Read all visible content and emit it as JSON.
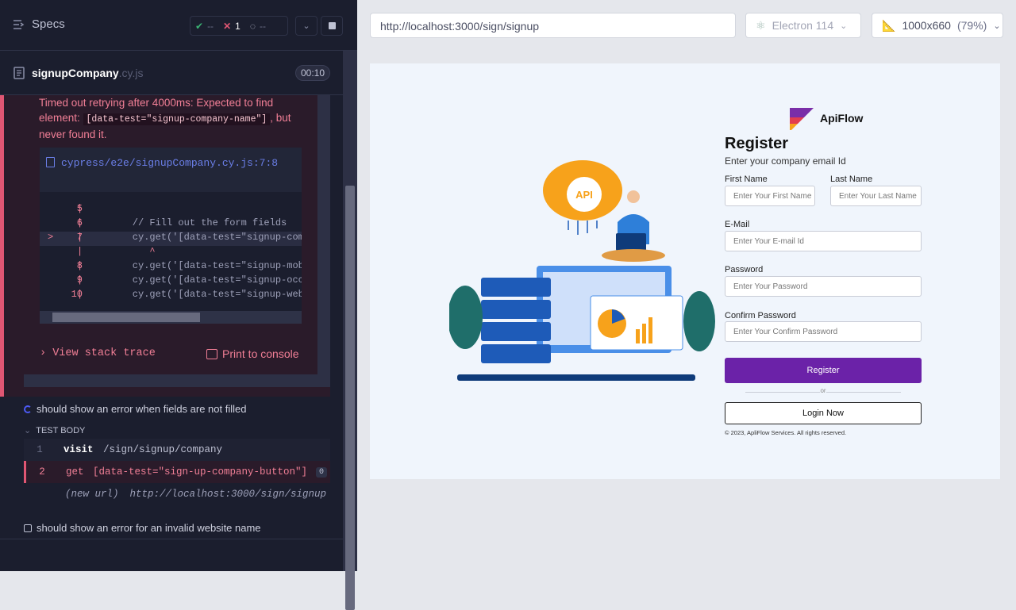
{
  "runner": {
    "specs_label": "Specs",
    "stats": {
      "passed": "--",
      "failed": "1",
      "pending": "--"
    },
    "file": {
      "name": "signupCompany",
      "ext": ".cy.js",
      "duration": "00:10"
    },
    "error": {
      "message_before": "Timed out retrying after 4000ms: Expected to find element: ",
      "selector": "[data-test=\"signup-company-name\"]",
      "message_after": ", but never found it.",
      "file_ref": "cypress/e2e/signupCompany.cy.js:7:8",
      "code_lines": [
        {
          "num": "5",
          "text": ""
        },
        {
          "num": "6",
          "text": "    // Fill out the form fields"
        },
        {
          "num": "7",
          "text": "    cy.get('[data-test=\"signup-company"
        },
        {
          "num": "",
          "text": "       ^"
        },
        {
          "num": "8",
          "text": "    cy.get('[data-test=\"signup-mobile\""
        },
        {
          "num": "9",
          "text": "    cy.get('[data-test=\"signup-occupat"
        },
        {
          "num": "10",
          "text": "    cy.get('[data-test=\"signup-website"
        }
      ],
      "view_stack_trace": "View stack trace",
      "print_to_console": "Print to console"
    },
    "test2": {
      "title": "should show an error when fields are not filled",
      "body_label": "TEST BODY",
      "commands": [
        {
          "num": "1",
          "name": "visit",
          "arg": "/sign/signup/company"
        },
        {
          "num": "2",
          "name": "get",
          "arg": "[data-test=\"sign-up-company-button\"]",
          "badge": "0"
        }
      ],
      "new_url_label": "(new url)",
      "new_url": "http://localhost:3000/sign/signup"
    },
    "test3": {
      "title": "should show an error for an invalid website name"
    }
  },
  "browser": {
    "url": "http://localhost:3000/sign/signup",
    "name": "Electron 114",
    "viewport": "1000x660",
    "zoom": "(79%)"
  },
  "app": {
    "brand": "ApiFlow",
    "illustration_badge": "API",
    "title": "Register",
    "subtitle": "Enter your company email Id",
    "first_name_label": "First Name",
    "first_name_placeholder": "Enter Your First Name",
    "last_name_label": "Last Name",
    "last_name_placeholder": "Enter Your Last Name",
    "email_label": "E-Mail",
    "email_placeholder": "Enter Your E-mail Id",
    "password_label": "Password",
    "password_placeholder": "Enter Your Password",
    "confirm_label": "Confirm Password",
    "confirm_placeholder": "Enter Your Confirm Password",
    "register_button": "Register",
    "or": "or",
    "login_button": "Login Now",
    "copyright": "© 2023, ApliFlow Services. All rights reserved."
  },
  "colors": {
    "fail": "#f17f96",
    "accent": "#6b22a8"
  }
}
